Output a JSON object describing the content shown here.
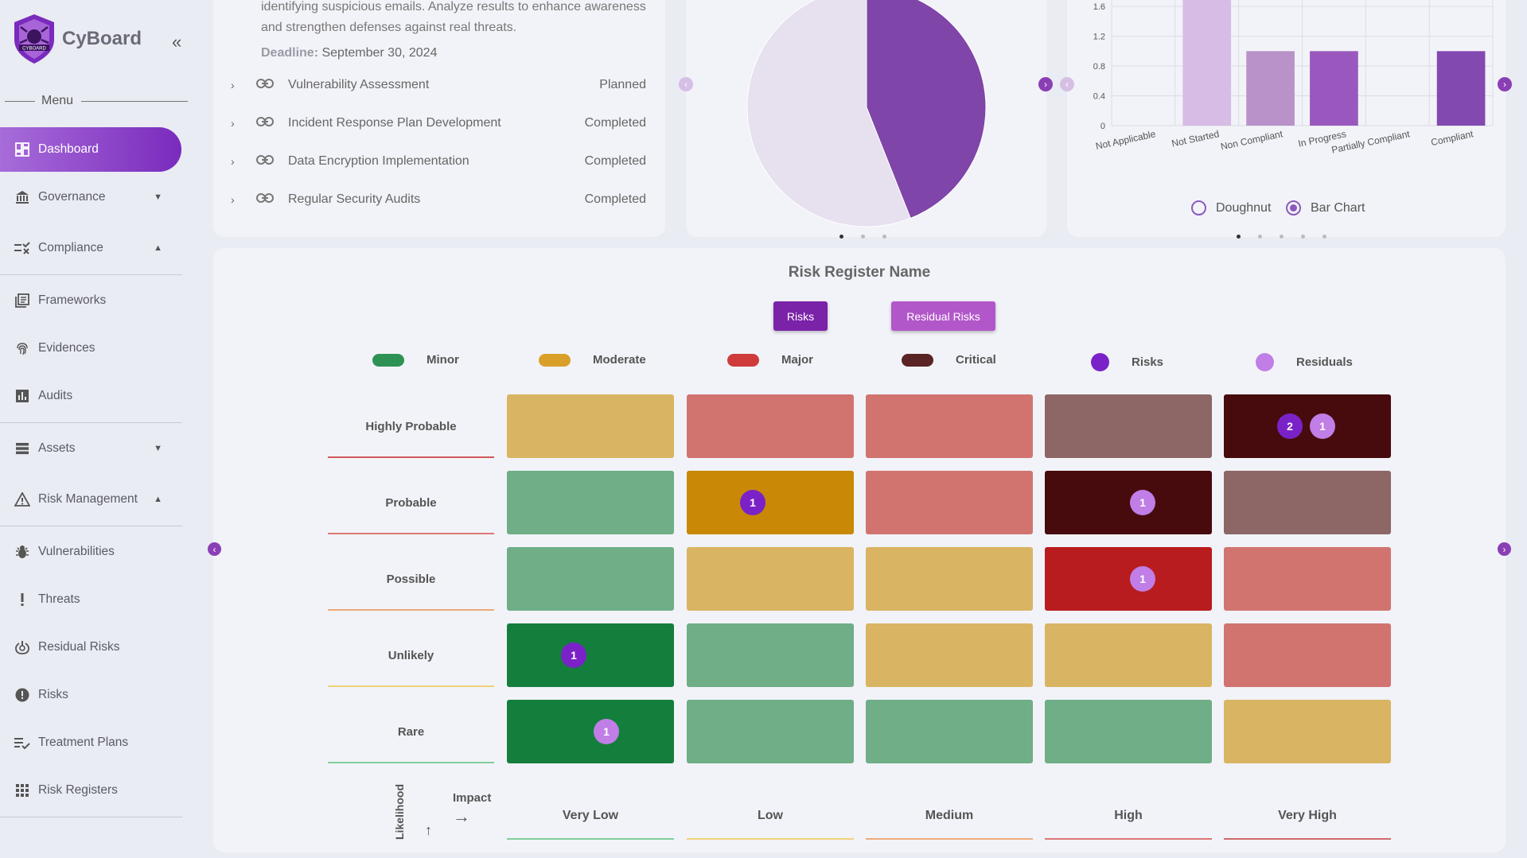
{
  "brand": {
    "name": "CyBoard",
    "logo_text": "CYBOARD"
  },
  "sidebar": {
    "menu_label": "Menu",
    "items": [
      {
        "label": "Dashboard"
      },
      {
        "label": "Governance"
      },
      {
        "label": "Compliance"
      },
      {
        "label": "Frameworks"
      },
      {
        "label": "Evidences"
      },
      {
        "label": "Audits"
      },
      {
        "label": "Assets"
      },
      {
        "label": "Risk Management"
      },
      {
        "label": "Vulnerabilities"
      },
      {
        "label": "Threats"
      },
      {
        "label": "Residual Risks"
      },
      {
        "label": "Risks"
      },
      {
        "label": "Treatment Plans"
      },
      {
        "label": "Risk Registers"
      }
    ]
  },
  "program_card": {
    "description": "identifying suspicious emails. Analyze results to enhance awareness and strengthen defenses against real threats.",
    "deadline_label": "Deadline:",
    "deadline_value": "September 30, 2024",
    "tasks": [
      {
        "name": "Vulnerability Assessment",
        "status": "Planned"
      },
      {
        "name": "Incident Response Plan Development",
        "status": "Completed"
      },
      {
        "name": "Data Encryption Implementation",
        "status": "Completed"
      },
      {
        "name": "Regular Security Audits",
        "status": "Completed"
      }
    ]
  },
  "bar_chart": {
    "categories": [
      "Not Applicable",
      "Not Started",
      "Non Compliant",
      "In Progress",
      "Partially Compliant",
      "Compliant"
    ],
    "y_ticks": [
      "0",
      "0.4",
      "0.8",
      "1.2",
      "1.6"
    ],
    "options": {
      "doughnut": "Doughnut",
      "bar": "Bar Chart"
    }
  },
  "chart_data": [
    {
      "type": "pie",
      "slices": [
        {
          "value": 0.56,
          "color": "#e6e0ef"
        },
        {
          "value": 0.44,
          "color": "#7f45a8"
        }
      ]
    },
    {
      "type": "bar",
      "categories": [
        "Not Applicable",
        "Not Started",
        "Non Compliant",
        "In Progress",
        "Partially Compliant",
        "Compliant"
      ],
      "values": [
        0,
        2,
        1,
        1,
        0,
        1
      ],
      "colors": [
        "#d8c3e5",
        "#d7bce6",
        "#b892c9",
        "#9a58be",
        "#8a4bb3",
        "#8249b0"
      ],
      "ylim": [
        0,
        1.9
      ]
    }
  ],
  "risk_register": {
    "title": "Risk Register Name",
    "tabs": {
      "risks": "Risks",
      "residual": "Residual Risks"
    },
    "legend": [
      {
        "label": "Minor",
        "color": "#2e9255"
      },
      {
        "label": "Moderate",
        "color": "#d9a029"
      },
      {
        "label": "Major",
        "color": "#cf3a3a"
      },
      {
        "label": "Critical",
        "color": "#5a2424"
      },
      {
        "label": "Risks",
        "color": "#7a22c8"
      },
      {
        "label": "Residuals",
        "color": "#c07ee6"
      }
    ],
    "likelihood_axis": "Likelihood",
    "impact_axis": "Impact",
    "rows": [
      "Highly Probable",
      "Probable",
      "Possible",
      "Unlikely",
      "Rare"
    ],
    "columns": [
      "Very Low",
      "Low",
      "Medium",
      "High",
      "Very High"
    ],
    "badges": {
      "hp_vh_risk": "2",
      "hp_vh_resid": "1",
      "pr_low_risk": "1",
      "pr_high_resid": "1",
      "po_high_resid": "1",
      "un_vl_risk": "1",
      "ra_vl_resid": "1"
    }
  }
}
